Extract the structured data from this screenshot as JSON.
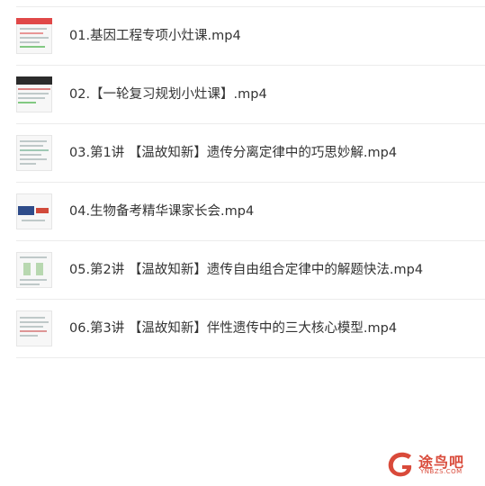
{
  "files": [
    {
      "name": "01.基因工程专项小灶课.mp4",
      "thumb": "slide-red-header"
    },
    {
      "name": "02.【一轮复习规划小灶课】.mp4",
      "thumb": "slide-dark-title"
    },
    {
      "name": "03.第1讲 【温故知新】遗传分离定律中的巧思妙解.mp4",
      "thumb": "slide-text-notes"
    },
    {
      "name": "04.生物备考精华课家长会.mp4",
      "thumb": "slide-presentation"
    },
    {
      "name": "05.第2讲 【温故知新】遗传自由组合定律中的解题快法.mp4",
      "thumb": "slide-diagram"
    },
    {
      "name": "06.第3讲 【温故知新】伴性遗传中的三大核心模型.mp4",
      "thumb": "slide-text-notes"
    }
  ],
  "watermark": {
    "text": "途鸟吧",
    "subtext": "YNBZS.COM"
  },
  "colors": {
    "text": "#333333",
    "divider": "#ececec",
    "watermark": "#d94a3a"
  }
}
